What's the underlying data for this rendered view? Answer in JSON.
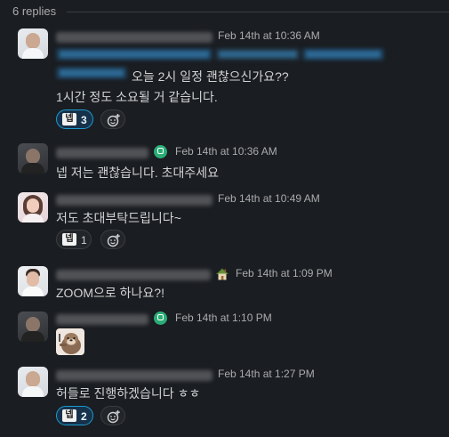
{
  "thread": {
    "replies_label": "6 replies"
  },
  "messages": [
    {
      "timestamp": "Feb 14th at 10:36 AM",
      "text_line1": "오늘 2시 일정 괜찮으신가요??",
      "text_line2": "1시간 정도 소요될 거 같습니다.",
      "reaction_emoji": "넵",
      "reaction_count": "3"
    },
    {
      "timestamp": "Feb 14th at 10:36 AM",
      "text": "넵 저는 괜찮습니다. 초대주세요"
    },
    {
      "timestamp": "Feb 14th at 10:49 AM",
      "text": "저도 초대부탁드립니다~",
      "reaction_emoji": "넵",
      "reaction_count": "1"
    },
    {
      "timestamp": "Feb 14th at 1:09 PM",
      "text": "ZOOM으로 하나요?!"
    },
    {
      "timestamp": "Feb 14th at 1:10 PM"
    },
    {
      "timestamp": "Feb 14th at 1:27 PM",
      "text": "허들로 진행하겠습니다 ㅎㅎ",
      "reaction_emoji": "넵",
      "reaction_count": "2"
    }
  ],
  "colors": {
    "background": "#1a1d21",
    "text": "#d1d2d3",
    "muted": "#ababad",
    "reaction_active_bg": "#16324b",
    "reaction_active_border": "#1d9bd1",
    "status_green": "#2bac76"
  },
  "icons": {
    "add_reaction": "smile-plus-icon",
    "status": "green-status-icon",
    "home_status": "house-icon"
  }
}
